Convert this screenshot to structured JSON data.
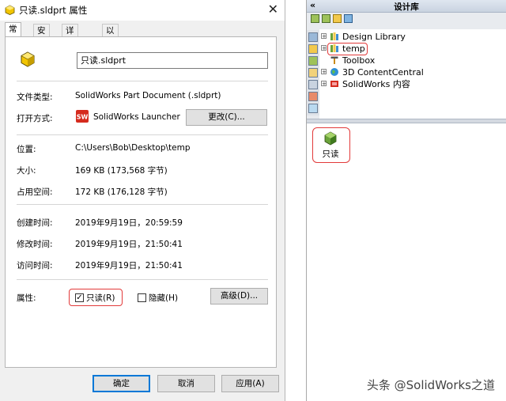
{
  "dialog": {
    "title": "只读.sldprt 属性",
    "close_label": "✕",
    "tabs": [
      {
        "label": "常规"
      },
      {
        "label": "安全"
      },
      {
        "label": "详细信息"
      },
      {
        "label": "以前的版本"
      }
    ],
    "file_name": "只读.sldprt",
    "file_type_label": "文件类型:",
    "file_type_value": "SolidWorks Part Document (.sldprt)",
    "open_with_label": "打开方式:",
    "open_with_value": "SolidWorks Launcher",
    "change_button": "更改(C)...",
    "location_label": "位置:",
    "location_value": "C:\\Users\\Bob\\Desktop\\temp",
    "size_label": "大小:",
    "size_value": "169 KB (173,568 字节)",
    "disk_size_label": "占用空间:",
    "disk_size_value": "172 KB (176,128 字节)",
    "created_label": "创建时间:",
    "created_value": "2019年9月19日，20:59:59",
    "modified_label": "修改时间:",
    "modified_value": "2019年9月19日，21:50:41",
    "accessed_label": "访问时间:",
    "accessed_value": "2019年9月19日，21:50:41",
    "attributes_label": "属性:",
    "readonly_label": "只读(R)",
    "readonly_checked": true,
    "hidden_label": "隐藏(H)",
    "hidden_checked": false,
    "advanced_button": "高级(D)...",
    "ok_button": "确定",
    "cancel_button": "取消",
    "apply_button": "应用(A)"
  },
  "library": {
    "title": "设计库",
    "collapse_label": "«",
    "tree": [
      {
        "label": "Design Library",
        "icon": "library-icon"
      },
      {
        "label": "temp",
        "icon": "library-icon"
      },
      {
        "label": "Toolbox",
        "icon": "toolbox-icon"
      },
      {
        "label": "3D ContentCentral",
        "icon": "globe-icon"
      },
      {
        "label": "SolidWorks 内容",
        "icon": "solidworks-content-icon"
      }
    ],
    "preview_item": {
      "label": "只读",
      "icon": "part-icon"
    }
  },
  "watermark": "头条 @SolidWorks之道",
  "colors": {
    "highlight": "#e23a3a",
    "accent": "#0078d7",
    "solidworks_red": "#d52b1e"
  }
}
